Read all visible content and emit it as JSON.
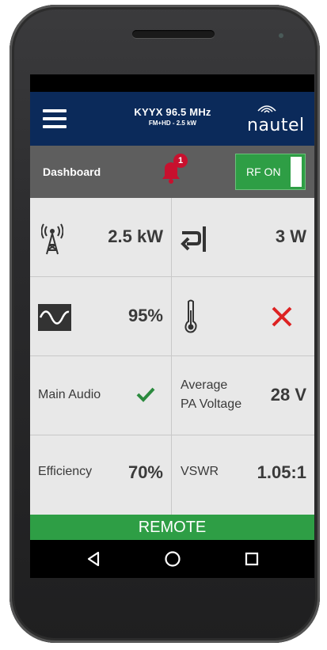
{
  "header": {
    "station_name": "KYYX 96.5 MHz",
    "station_detail": "FM+HD - 2.5 kW",
    "brand": "nautel"
  },
  "dashboard": {
    "label": "Dashboard",
    "alarm_count": "1",
    "rf_label": "RF ON"
  },
  "metrics": {
    "forward_power": "2.5 kW",
    "reflected_power": "3 W",
    "modulation": "95%",
    "main_audio_label": "Main Audio",
    "avg_pa_voltage_label_1": "Average",
    "avg_pa_voltage_label_2": "PA Voltage",
    "avg_pa_voltage": "28 V",
    "efficiency_label": "Efficiency",
    "efficiency": "70%",
    "vswr_label": "VSWR",
    "vswr": "1.05:1"
  },
  "footer": {
    "remote": "REMOTE"
  },
  "colors": {
    "header_bg": "#0b2a5a",
    "dashbar_bg": "#5e5e5e",
    "green": "#2e9e45",
    "alarm_red": "#c8102e"
  }
}
